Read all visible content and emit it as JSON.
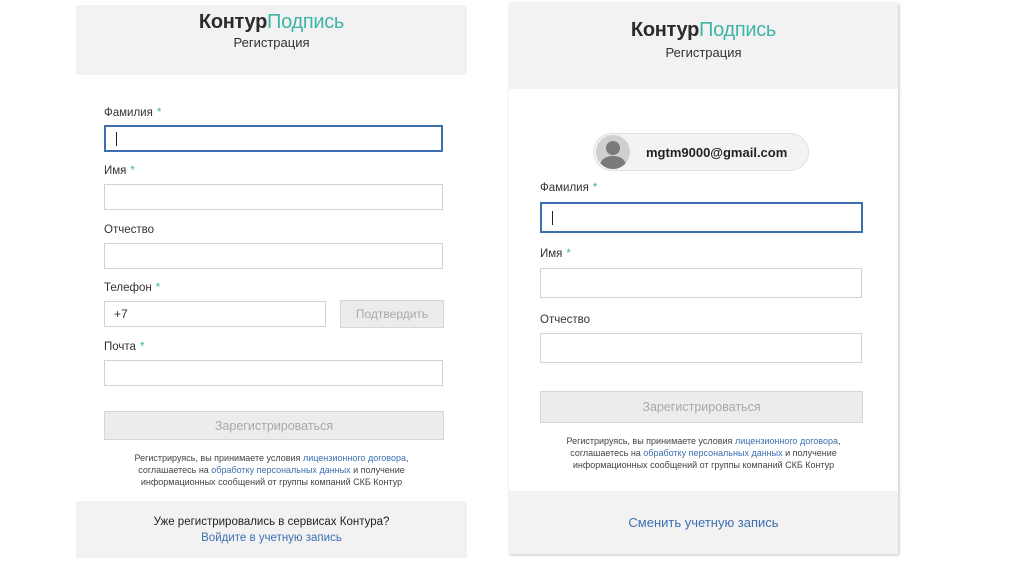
{
  "brand": {
    "part1": "Контур",
    "part2": "Подпись"
  },
  "subtitle": "Регистрация",
  "colors": {
    "accent": "#3fb5a4",
    "link": "#3d6fb0",
    "focus_border": "#3d6fb0",
    "header_bg": "#f2f2f2"
  },
  "left": {
    "fields": {
      "last_name": {
        "label": "Фамилия",
        "required": "*"
      },
      "first_name": {
        "label": "Имя",
        "required": "*"
      },
      "middle_name": {
        "label": "Отчество"
      },
      "phone": {
        "label": "Телефон",
        "required": "*",
        "value": "+7"
      },
      "email": {
        "label": "Почта",
        "required": "*"
      }
    },
    "confirm_button": "Подтвердить",
    "register_button": "Зарегистрироваться",
    "terms": {
      "line1_text": "Регистрируясь, вы принимаете условия ",
      "license_link": "лицензионного договора",
      "line1_end": ",",
      "line2_start": "соглашаетесь на ",
      "data_link": "обработку персональных данных",
      "line2_end": " и получение",
      "line3": "информационных сообщений от группы компаний СКБ Контур"
    },
    "footer": {
      "question": "Уже регистрировались в сервисах Контура?",
      "login_link": "Войдите в учетную запись"
    }
  },
  "right": {
    "account_email": "mgtm9000@gmail.com",
    "avatar_icon": "user-silhouette-icon",
    "fields": {
      "last_name": {
        "label": "Фамилия",
        "required": "*"
      },
      "first_name": {
        "label": "Имя",
        "required": "*"
      },
      "middle_name": {
        "label": "Отчество"
      }
    },
    "register_button": "Зарегистрироваться",
    "terms": {
      "line1_text": "Регистрируясь, вы принимаете условия ",
      "license_link": "лицензионного договора",
      "line1_end": ",",
      "line2_start": "соглашаетесь на ",
      "data_link": "обработку персональных данных",
      "line2_end": " и получение",
      "line3": "информационных сообщений от группы компаний СКБ Контур"
    },
    "footer": {
      "switch_link": "Сменить учетную запись"
    }
  }
}
